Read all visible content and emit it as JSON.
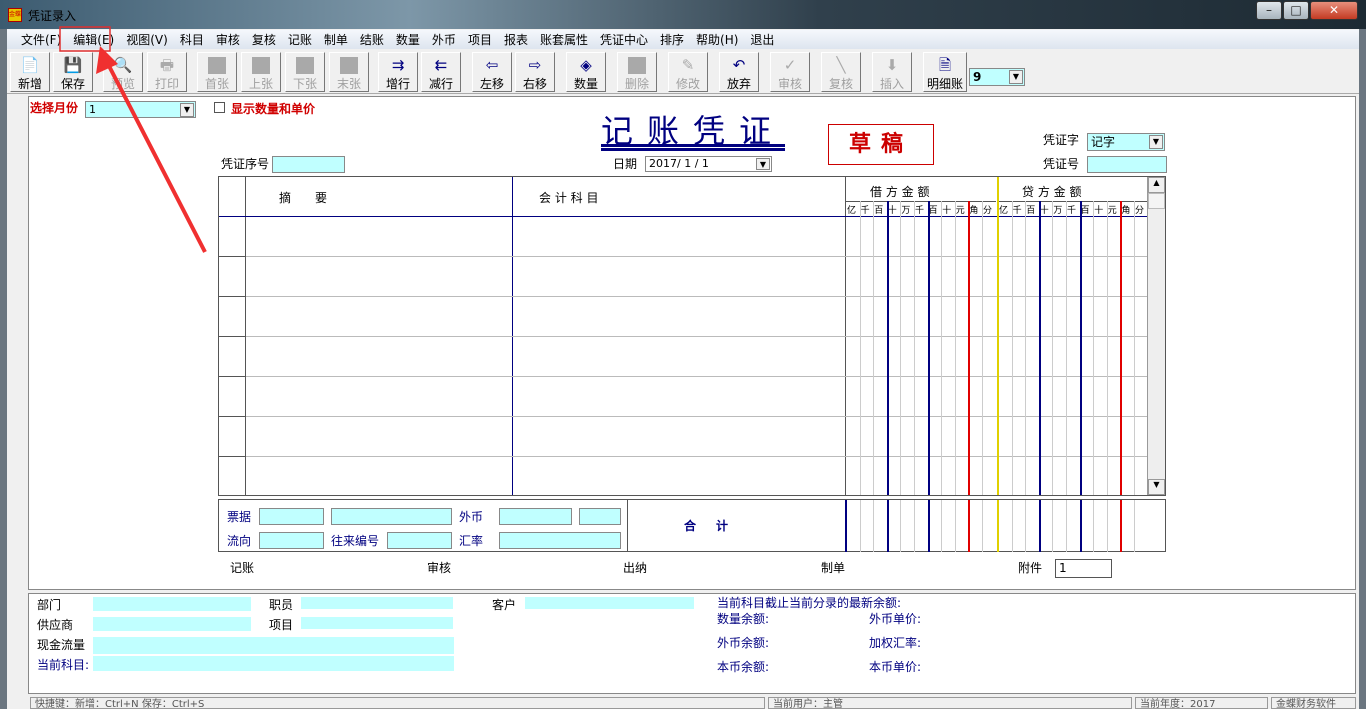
{
  "window": {
    "title": "凭证录入",
    "icon_text": "金蝶",
    "min": "–",
    "max": "□",
    "close": "✕"
  },
  "menu": [
    "文件(F)",
    "编辑(E)",
    "视图(V)",
    "科目",
    "审核",
    "复核",
    "记账",
    "制单",
    "结账",
    "数量",
    "外币",
    "项目",
    "报表",
    "账套属性",
    "凭证中心",
    "排序",
    "帮助(H)",
    "退出"
  ],
  "toolbar": [
    {
      "label": "新增",
      "icon": "📄",
      "enabled": true
    },
    {
      "label": "保存",
      "icon": "💾",
      "enabled": true
    },
    {
      "label": "预览",
      "icon": "🔍",
      "enabled": false
    },
    {
      "label": "打印",
      "icon": "🖶",
      "enabled": false
    },
    {
      "label": "首张",
      "icon": "box",
      "enabled": false
    },
    {
      "label": "上张",
      "icon": "box",
      "enabled": false
    },
    {
      "label": "下张",
      "icon": "box",
      "enabled": false
    },
    {
      "label": "末张",
      "icon": "box",
      "enabled": false
    },
    {
      "label": "增行",
      "icon": "⇉",
      "enabled": true
    },
    {
      "label": "减行",
      "icon": "⇇",
      "enabled": true
    },
    {
      "label": "左移",
      "icon": "⇦",
      "enabled": true
    },
    {
      "label": "右移",
      "icon": "⇨",
      "enabled": true
    },
    {
      "label": "数量",
      "icon": "◈",
      "enabled": true
    },
    {
      "label": "删除",
      "icon": "box",
      "enabled": false
    },
    {
      "label": "修改",
      "icon": "✎",
      "enabled": false
    },
    {
      "label": "放弃",
      "icon": "↶",
      "enabled": true
    },
    {
      "label": "审核",
      "icon": "✓",
      "enabled": false
    },
    {
      "label": "复核",
      "icon": "╲",
      "enabled": false
    },
    {
      "label": "插入",
      "icon": "⬇",
      "enabled": false
    },
    {
      "label": "明细账",
      "icon": "🗎",
      "enabled": true
    }
  ],
  "toolbar_combo": "9",
  "header": {
    "month_label": "选择月份",
    "month_value": "1",
    "show_qty_label": "显示数量和单价",
    "title": "记账凭证",
    "draft": "草稿",
    "seq_label": "凭证序号",
    "date_label": "日期",
    "date_value": "2017/ 1 / 1",
    "word_label": "凭证字",
    "word_value": "记字",
    "no_label": "凭证号"
  },
  "grid": {
    "summary": "摘　　要",
    "account": "会 计 科 目",
    "debit": "借 方 金 额",
    "credit": "贷 方 金 额",
    "digits": [
      "亿",
      "千",
      "百",
      "十",
      "万",
      "千",
      "百",
      "十",
      "元",
      "角",
      "分"
    ],
    "rows": 7
  },
  "bottom": {
    "bill": "票据",
    "foreign": "外币",
    "flow": "流向",
    "contact_no": "往来编号",
    "rate": "汇率",
    "total": "合　计"
  },
  "signers": {
    "post": "记账",
    "audit": "审核",
    "cashier": "出纳",
    "maker": "制单",
    "attach": "附件",
    "attach_value": "1"
  },
  "lower": {
    "dept": "部门",
    "staff": "职员",
    "customer": "客户",
    "supplier": "供应商",
    "project": "项目",
    "cashflow": "现金流量",
    "current_account": "当前科目:",
    "balance_title": "当前科目截止当前分录的最新余额:",
    "qty_bal": "数量余额:",
    "fc_price": "外币单价:",
    "fc_bal": "外币余额:",
    "w_rate": "加权汇率:",
    "lc_bal": "本币余额:",
    "lc_price": "本币单价:"
  },
  "status": {
    "shortcuts": "快捷键：新增：Ctrl+N 保存：Ctrl+S",
    "user": "当前用户：主管",
    "year": "当前年度：2017",
    "product": "金蝶财务软件"
  }
}
